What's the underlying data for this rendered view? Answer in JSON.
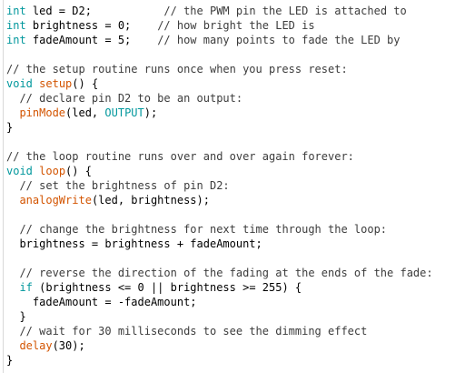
{
  "editor": {
    "lines": [
      [
        {
          "t": "type",
          "s": "int"
        },
        {
          "t": "plain",
          "s": " led = D2;           "
        },
        {
          "t": "comment",
          "s": "// the PWM pin the LED is attached to"
        }
      ],
      [
        {
          "t": "type",
          "s": "int"
        },
        {
          "t": "plain",
          "s": " brightness = 0;    "
        },
        {
          "t": "comment",
          "s": "// how bright the LED is"
        }
      ],
      [
        {
          "t": "type",
          "s": "int"
        },
        {
          "t": "plain",
          "s": " fadeAmount = 5;    "
        },
        {
          "t": "comment",
          "s": "// how many points to fade the LED by"
        }
      ],
      [],
      [
        {
          "t": "comment",
          "s": "// the setup routine runs once when you press reset:"
        }
      ],
      [
        {
          "t": "type",
          "s": "void"
        },
        {
          "t": "plain",
          "s": " "
        },
        {
          "t": "func",
          "s": "setup"
        },
        {
          "t": "plain",
          "s": "() {"
        }
      ],
      [
        {
          "t": "plain",
          "s": "  "
        },
        {
          "t": "comment",
          "s": "// declare pin D2 to be an output:"
        }
      ],
      [
        {
          "t": "plain",
          "s": "  "
        },
        {
          "t": "func",
          "s": "pinMode"
        },
        {
          "t": "plain",
          "s": "(led, "
        },
        {
          "t": "const",
          "s": "OUTPUT"
        },
        {
          "t": "plain",
          "s": ");"
        }
      ],
      [
        {
          "t": "plain",
          "s": "}"
        }
      ],
      [],
      [
        {
          "t": "comment",
          "s": "// the loop routine runs over and over again forever:"
        }
      ],
      [
        {
          "t": "type",
          "s": "void"
        },
        {
          "t": "plain",
          "s": " "
        },
        {
          "t": "func",
          "s": "loop"
        },
        {
          "t": "plain",
          "s": "() {"
        }
      ],
      [
        {
          "t": "plain",
          "s": "  "
        },
        {
          "t": "comment",
          "s": "// set the brightness of pin D2:"
        }
      ],
      [
        {
          "t": "plain",
          "s": "  "
        },
        {
          "t": "func",
          "s": "analogWrite"
        },
        {
          "t": "plain",
          "s": "(led, brightness);"
        }
      ],
      [],
      [
        {
          "t": "plain",
          "s": "  "
        },
        {
          "t": "comment",
          "s": "// change the brightness for next time through the loop:"
        }
      ],
      [
        {
          "t": "plain",
          "s": "  brightness = brightness + fadeAmount;"
        }
      ],
      [],
      [
        {
          "t": "plain",
          "s": "  "
        },
        {
          "t": "comment",
          "s": "// reverse the direction of the fading at the ends of the fade:"
        }
      ],
      [
        {
          "t": "plain",
          "s": "  "
        },
        {
          "t": "type",
          "s": "if"
        },
        {
          "t": "plain",
          "s": " (brightness <= 0 || brightness >= 255) {"
        }
      ],
      [
        {
          "t": "plain",
          "s": "    fadeAmount = -fadeAmount;"
        }
      ],
      [
        {
          "t": "plain",
          "s": "  }"
        }
      ],
      [
        {
          "t": "plain",
          "s": "  "
        },
        {
          "t": "comment",
          "s": "// wait for 30 milliseconds to see the dimming effect"
        }
      ],
      [
        {
          "t": "plain",
          "s": "  "
        },
        {
          "t": "func",
          "s": "delay"
        },
        {
          "t": "plain",
          "s": "(30);"
        }
      ],
      [
        {
          "t": "plain",
          "s": "}"
        }
      ]
    ],
    "colors": {
      "type": "#00979c",
      "func": "#d35400",
      "const": "#00979c",
      "comment": "#3c3c3c",
      "plain": "#000000",
      "background": "#ffffff"
    }
  }
}
